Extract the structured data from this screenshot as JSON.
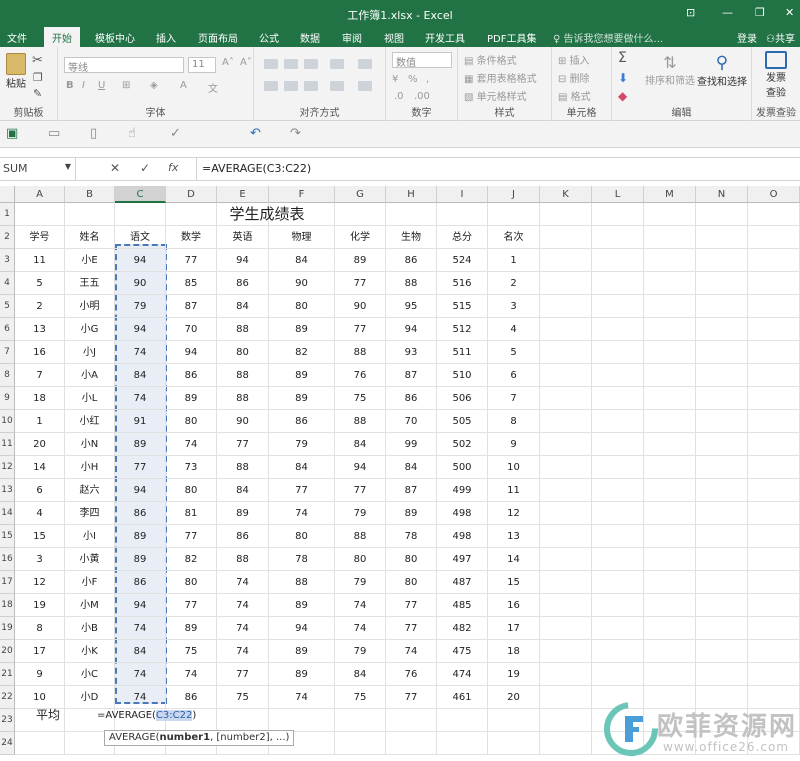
{
  "app": {
    "title": "工作簿1.xlsx - Excel",
    "tabs": [
      "文件",
      "开始",
      "模板中心",
      "插入",
      "页面布局",
      "公式",
      "数据",
      "审阅",
      "视图",
      "开发工具",
      "PDF工具集"
    ],
    "active_tab": "开始",
    "tellme": "告诉我您想要做什么...",
    "login": "登录",
    "share": "共享"
  },
  "ribbon": {
    "paste": "粘贴",
    "clipboard": "剪贴板",
    "font_name": "等线",
    "font_size": "11",
    "font": "字体",
    "alignment": "对齐方式",
    "number_format": "数值",
    "number": "数字",
    "cond_format": "条件格式",
    "table_format": "套用表格格式",
    "cell_style": "单元格样式",
    "styles": "样式",
    "insert": "插入",
    "delete": "删除",
    "format": "格式",
    "cells": "单元格",
    "sort_filter": "排序和筛选",
    "find_select": "查找和选择",
    "editing": "编辑",
    "invoice_line1": "发票",
    "invoice_line2": "查验",
    "invoice_group": "发票查验"
  },
  "formula_bar": {
    "name_box": "SUM",
    "cancel": "✕",
    "enter": "✓",
    "fx": "fx",
    "formula": "=AVERAGE(C3:C22)"
  },
  "sheet": {
    "columns": [
      "A",
      "B",
      "C",
      "D",
      "E",
      "F",
      "G",
      "H",
      "I",
      "J",
      "K",
      "L",
      "M",
      "N",
      "O"
    ],
    "row_numbers": [
      "1",
      "2",
      "3",
      "4",
      "5",
      "6",
      "7",
      "8",
      "9",
      "10",
      "11",
      "12",
      "13",
      "14",
      "15",
      "16",
      "17",
      "18",
      "19",
      "20",
      "21",
      "22",
      "23",
      "24"
    ],
    "title": "学生成绩表",
    "headers": [
      "学号",
      "姓名",
      "语文",
      "数学",
      "英语",
      "物理",
      "化学",
      "生物",
      "总分",
      "名次"
    ],
    "rows": [
      [
        "11",
        "小E",
        "94",
        "77",
        "94",
        "84",
        "89",
        "86",
        "524",
        "1"
      ],
      [
        "5",
        "王五",
        "90",
        "85",
        "86",
        "90",
        "77",
        "88",
        "516",
        "2"
      ],
      [
        "2",
        "小明",
        "79",
        "87",
        "84",
        "80",
        "90",
        "95",
        "515",
        "3"
      ],
      [
        "13",
        "小G",
        "94",
        "70",
        "88",
        "89",
        "77",
        "94",
        "512",
        "4"
      ],
      [
        "16",
        "小J",
        "74",
        "94",
        "80",
        "82",
        "88",
        "93",
        "511",
        "5"
      ],
      [
        "7",
        "小A",
        "84",
        "86",
        "88",
        "89",
        "76",
        "87",
        "510",
        "6"
      ],
      [
        "18",
        "小L",
        "74",
        "89",
        "88",
        "89",
        "75",
        "86",
        "506",
        "7"
      ],
      [
        "1",
        "小红",
        "91",
        "80",
        "90",
        "86",
        "88",
        "70",
        "505",
        "8"
      ],
      [
        "20",
        "小N",
        "89",
        "74",
        "77",
        "79",
        "84",
        "99",
        "502",
        "9"
      ],
      [
        "14",
        "小H",
        "77",
        "73",
        "88",
        "84",
        "94",
        "84",
        "500",
        "10"
      ],
      [
        "6",
        "赵六",
        "94",
        "80",
        "84",
        "77",
        "77",
        "87",
        "499",
        "11"
      ],
      [
        "4",
        "李四",
        "86",
        "81",
        "89",
        "74",
        "79",
        "89",
        "498",
        "12"
      ],
      [
        "15",
        "小I",
        "89",
        "77",
        "86",
        "80",
        "88",
        "78",
        "498",
        "13"
      ],
      [
        "3",
        "小黄",
        "89",
        "82",
        "88",
        "78",
        "80",
        "80",
        "497",
        "14"
      ],
      [
        "12",
        "小F",
        "86",
        "80",
        "74",
        "88",
        "79",
        "80",
        "487",
        "15"
      ],
      [
        "19",
        "小M",
        "94",
        "77",
        "74",
        "89",
        "74",
        "77",
        "485",
        "16"
      ],
      [
        "8",
        "小B",
        "74",
        "89",
        "74",
        "94",
        "74",
        "77",
        "482",
        "17"
      ],
      [
        "17",
        "小K",
        "84",
        "75",
        "74",
        "89",
        "79",
        "74",
        "475",
        "18"
      ],
      [
        "9",
        "小C",
        "74",
        "74",
        "77",
        "89",
        "84",
        "76",
        "474",
        "19"
      ],
      [
        "10",
        "小D",
        "74",
        "86",
        "75",
        "74",
        "75",
        "77",
        "461",
        "20"
      ]
    ],
    "avg_label": "平均",
    "editing_formula_prefix": "=AVERAGE(",
    "editing_formula_ref": "C3:C22",
    "editing_formula_suffix": ")",
    "tooltip_fn": "AVERAGE(",
    "tooltip_arg1": "number1",
    "tooltip_rest": ", [number2], ...)"
  },
  "watermark": {
    "name": "欧菲资源网",
    "url": "www.office26.com"
  }
}
